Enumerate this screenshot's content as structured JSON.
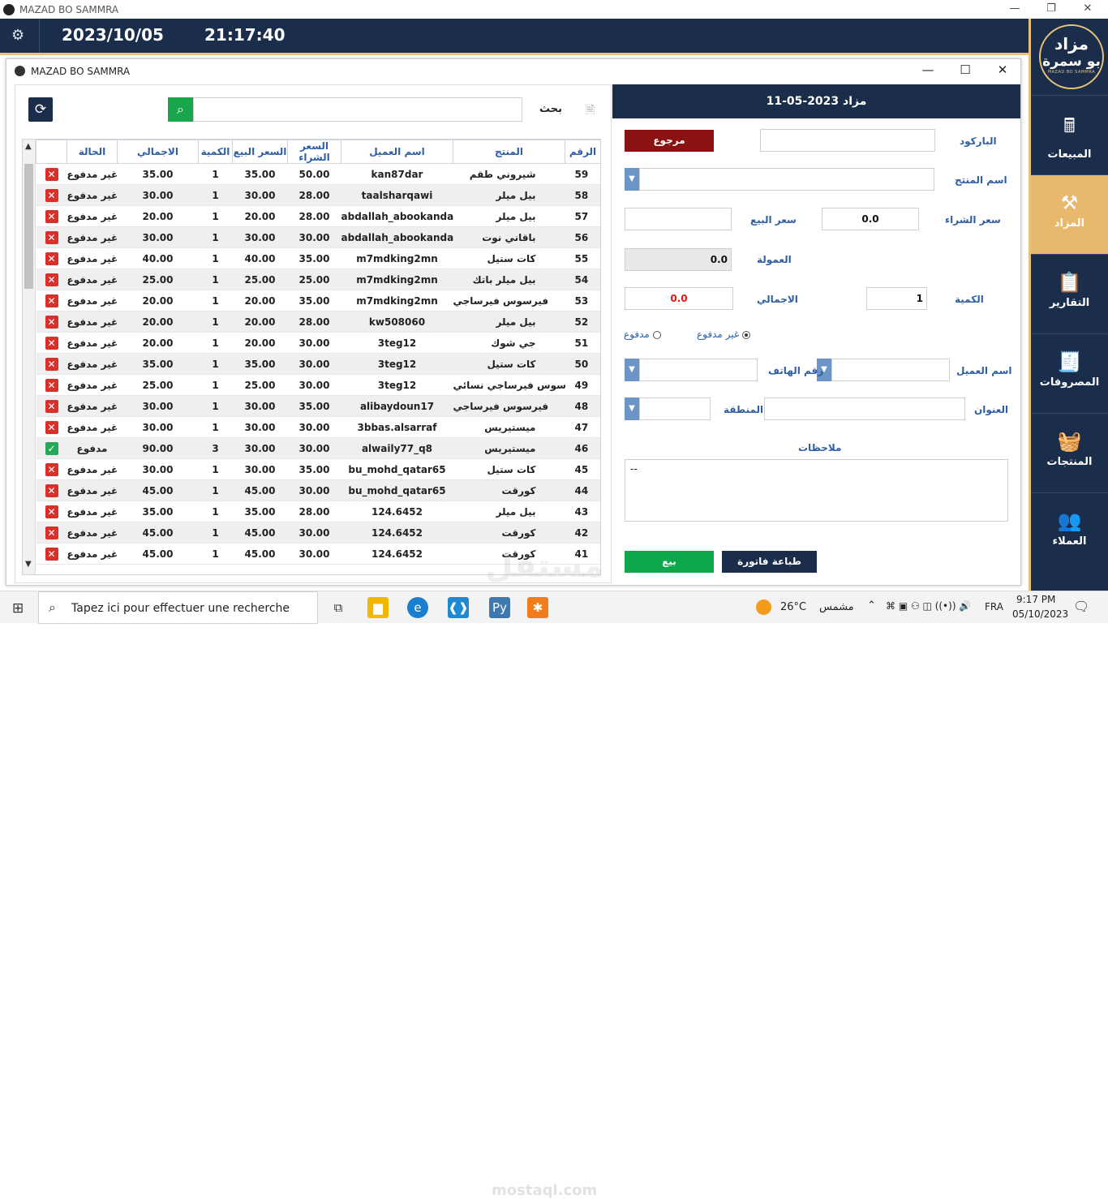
{
  "window": {
    "title": "MAZAD BO SAMMRA"
  },
  "header": {
    "date": "2023/10/05",
    "time": "21:17:40"
  },
  "logo": {
    "line1": "مزاد",
    "line2": "بو سمرة",
    "line3": "MAZAD BO SAMMRA"
  },
  "nav": [
    {
      "label": "المبيعات",
      "icon": "sales-icon",
      "glyph": "🖩"
    },
    {
      "label": "المزاد",
      "icon": "gavel-icon",
      "glyph": "⚒"
    },
    {
      "label": "التقارير",
      "icon": "report-icon",
      "glyph": "📋"
    },
    {
      "label": "المصروفات",
      "icon": "expenses-icon",
      "glyph": "🧾"
    },
    {
      "label": "المنتجات",
      "icon": "products-icon",
      "glyph": "🧺"
    },
    {
      "label": "العملاء",
      "icon": "customers-icon",
      "glyph": "👥"
    }
  ],
  "nav_active": 1,
  "dialog": {
    "title": "MAZAD BO SAMMRA"
  },
  "search": {
    "label": "بحث",
    "value": ""
  },
  "table": {
    "headers": [
      "الرقم",
      "المنتج",
      "اسم العميل",
      "السعر الشراء",
      "السعر البيع",
      "الكمية",
      "الاجمالي",
      "الحالة"
    ],
    "rows": [
      {
        "num": "59",
        "product": "شيروني طقم",
        "customer": "kan87dar",
        "buy": "50.00",
        "sell": "35.00",
        "qty": "1",
        "total": "35.00",
        "status": "غير مدفوع",
        "paid": false
      },
      {
        "num": "58",
        "product": "بيل ميلر",
        "customer": "taalsharqawi",
        "buy": "28.00",
        "sell": "30.00",
        "qty": "1",
        "total": "30.00",
        "status": "غير مدفوع",
        "paid": false
      },
      {
        "num": "57",
        "product": "بيل ميلر",
        "customer": "abdallah_abookandar",
        "buy": "28.00",
        "sell": "20.00",
        "qty": "1",
        "total": "20.00",
        "status": "غير مدفوع",
        "paid": false
      },
      {
        "num": "56",
        "product": "باقاني نوت",
        "customer": "abdallah_abookandar",
        "buy": "30.00",
        "sell": "30.00",
        "qty": "1",
        "total": "30.00",
        "status": "غير مدفوع",
        "paid": false
      },
      {
        "num": "55",
        "product": "كات ستيل",
        "customer": "m7mdking2mn",
        "buy": "35.00",
        "sell": "40.00",
        "qty": "1",
        "total": "40.00",
        "status": "غير مدفوع",
        "paid": false
      },
      {
        "num": "54",
        "product": "بيل ميلر باتك",
        "customer": "m7mdking2mn",
        "buy": "25.00",
        "sell": "25.00",
        "qty": "1",
        "total": "25.00",
        "status": "غير مدفوع",
        "paid": false
      },
      {
        "num": "53",
        "product": "فيرسوس فيرساجي",
        "customer": "m7mdking2mn",
        "buy": "35.00",
        "sell": "20.00",
        "qty": "1",
        "total": "20.00",
        "status": "غير مدفوع",
        "paid": false
      },
      {
        "num": "52",
        "product": "بيل ميلر",
        "customer": "kw508060",
        "buy": "28.00",
        "sell": "20.00",
        "qty": "1",
        "total": "20.00",
        "status": "غير مدفوع",
        "paid": false
      },
      {
        "num": "51",
        "product": "جي شوك",
        "customer": "3teg12",
        "buy": "30.00",
        "sell": "20.00",
        "qty": "1",
        "total": "20.00",
        "status": "غير مدفوع",
        "paid": false
      },
      {
        "num": "50",
        "product": "كات ستيل",
        "customer": "3teg12",
        "buy": "30.00",
        "sell": "35.00",
        "qty": "1",
        "total": "35.00",
        "status": "غير مدفوع",
        "paid": false
      },
      {
        "num": "49",
        "product": "فيرسوس فيرساجي نسائي",
        "customer": "3teg12",
        "buy": "30.00",
        "sell": "25.00",
        "qty": "1",
        "total": "25.00",
        "status": "غير مدفوع",
        "paid": false
      },
      {
        "num": "48",
        "product": "فيرسوس فيرساجي",
        "customer": "alibaydoun17",
        "buy": "35.00",
        "sell": "30.00",
        "qty": "1",
        "total": "30.00",
        "status": "غير مدفوع",
        "paid": false
      },
      {
        "num": "47",
        "product": "ميستيريس",
        "customer": "3bbas.alsarraf",
        "buy": "30.00",
        "sell": "30.00",
        "qty": "1",
        "total": "30.00",
        "status": "غير مدفوع",
        "paid": false
      },
      {
        "num": "46",
        "product": "ميستيريس",
        "customer": "alwaily77_q8",
        "buy": "30.00",
        "sell": "30.00",
        "qty": "3",
        "total": "90.00",
        "status": "مدفوع",
        "paid": true
      },
      {
        "num": "45",
        "product": "كات ستيل",
        "customer": "bu_mohd_qatar65",
        "buy": "35.00",
        "sell": "30.00",
        "qty": "1",
        "total": "30.00",
        "status": "غير مدفوع",
        "paid": false
      },
      {
        "num": "44",
        "product": "كورقت",
        "customer": "bu_mohd_qatar65",
        "buy": "30.00",
        "sell": "45.00",
        "qty": "1",
        "total": "45.00",
        "status": "غير مدفوع",
        "paid": false
      },
      {
        "num": "43",
        "product": "بيل ميلر",
        "customer": "124.6452",
        "buy": "28.00",
        "sell": "35.00",
        "qty": "1",
        "total": "35.00",
        "status": "غير مدفوع",
        "paid": false
      },
      {
        "num": "42",
        "product": "كورقت",
        "customer": "124.6452",
        "buy": "30.00",
        "sell": "45.00",
        "qty": "1",
        "total": "45.00",
        "status": "غير مدفوع",
        "paid": false
      },
      {
        "num": "41",
        "product": "كورقت",
        "customer": "124.6452",
        "buy": "30.00",
        "sell": "45.00",
        "qty": "1",
        "total": "45.00",
        "status": "غير مدفوع",
        "paid": false
      }
    ]
  },
  "form": {
    "header": "مزاد 2023-05-11",
    "barcode_label": "الباركود",
    "barcode_value": "",
    "return_button": "مرجوع",
    "product_label": "اسم المنتج",
    "product_value": "",
    "buy_price_label": "سعر الشراء",
    "buy_price_value": "0.0",
    "sell_price_label": "سعر البيع",
    "sell_price_value": "",
    "commission_label": "العمولة",
    "commission_value": "0.0",
    "qty_label": "الكمية",
    "qty_value": "1",
    "total_label": "الاجمالي",
    "total_value": "0.0",
    "radio_unpaid": "غير مدفوع",
    "radio_paid": "مدفوع",
    "radio_selected": "unpaid",
    "customer_label": "اسم العميل",
    "customer_value": "",
    "phone_label": "رقم الهاتف",
    "phone_value": "",
    "address_label": "العنوان",
    "address_value": "",
    "region_label": "المنطقة",
    "region_value": "",
    "notes_label": "ملاحظات",
    "notes_value": "--",
    "sell_button": "بيع",
    "print_button": "طباعة فاتورة",
    "colors": {
      "return": "#8b1212",
      "sell": "#0ea84c",
      "print": "#1a2d4a",
      "total_text": "#e01818"
    }
  },
  "taskbar": {
    "search_placeholder": "Tapez ici pour effectuer une recherche",
    "weather_temp": "26°C",
    "weather_text": "مشمس",
    "lang": "FRA",
    "clock_time": "9:17 PM",
    "clock_date": "05/10/2023"
  },
  "watermark": {
    "main": "مستقل",
    "sub": "mostaql.com"
  }
}
